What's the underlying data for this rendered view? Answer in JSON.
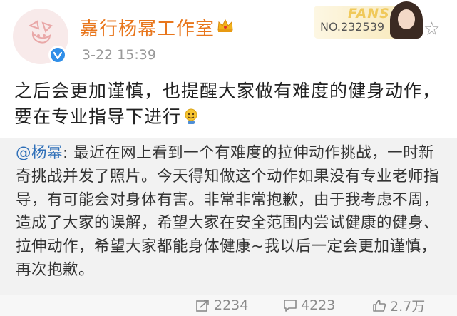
{
  "header": {
    "username": "嘉行杨幂工作室",
    "timestamp": "3-22 15:39",
    "fans_badge": {
      "title": "FANS",
      "number": "NO.232539"
    }
  },
  "post": {
    "text": "之后会更加谨慎，也提醒大家做有难度的健身动作，要在专业指导下进行"
  },
  "repost": {
    "author": "@杨幂",
    "text": ": 最近在网上看到一个有难度的拉伸动作挑战，一时新奇挑战并发了照片。今天得知做这个动作如果没有专业老师指导，有可能会对身体有害。非常非常抱歉，由于我考虑不周，造成了大家的误解，希望大家在安全范围内尝试健康的健身、拉伸动作，希望大家都能身体健康~我以后一定会更加谨慎，再次抱歉。"
  },
  "actions": {
    "share_count": "2234",
    "comment_count": "4223",
    "like_count": "2.7万"
  },
  "colors": {
    "username": "#e8761c",
    "link": "#2e6fb8",
    "verified": "#2f8ee8",
    "muted": "#9a9a9a"
  },
  "icons": [
    "verified-icon",
    "crown-icon",
    "star-icon",
    "share-icon",
    "comment-icon",
    "like-icon",
    "emoji-icon"
  ]
}
